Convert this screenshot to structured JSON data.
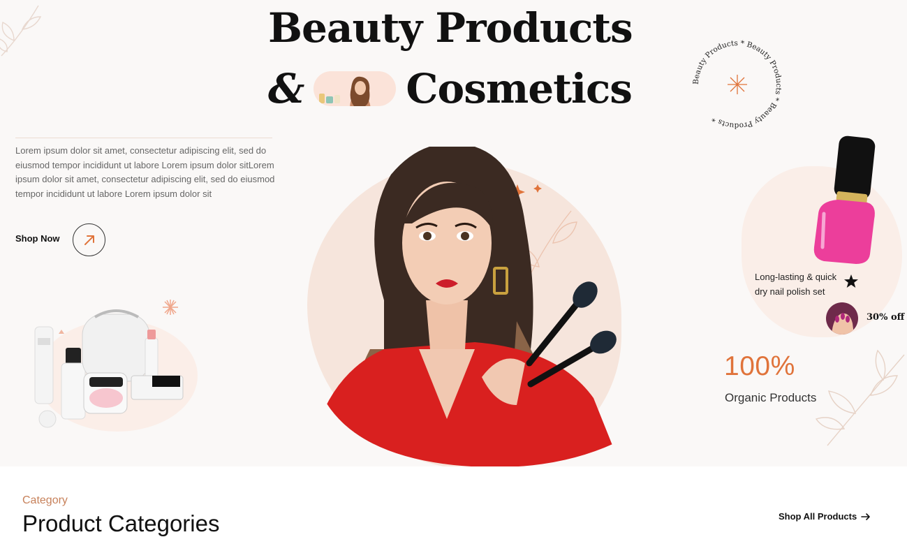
{
  "hero": {
    "title_line1": "Beauty Products",
    "title_amp": "&",
    "title_line2": "Cosmetics",
    "intro_text": "Lorem ipsum dolor sit amet, consectetur adipiscing elit, sed do eiusmod tempor incididunt ut labore Lorem ipsum dolor sitLorem ipsum dolor sit amet, consectetur adipiscing elit, sed do eiusmod tempor incididunt ut labore Lorem ipsum dolor sit",
    "shop_now_label": "Shop Now",
    "shop_now_icon": "arrow-up-right-icon",
    "stamp_text": "Beauty Products * Beauty Products * Beauty Products * ",
    "nail_caption": "Long-lasting & quick dry nail polish set",
    "discount": "30% off",
    "stat_value": "100%",
    "stat_label": "Organic Products"
  },
  "category": {
    "eyebrow": "Category",
    "title": "Product Categories",
    "shop_all_label": "Shop All Products",
    "shop_all_icon": "arrow-right-icon"
  },
  "colors": {
    "accent": "#e0733a",
    "eyebrow": "#c7815a",
    "blush": "#f6e5dc",
    "nail_pink": "#ec3e9b",
    "dress_red": "#d9201f"
  }
}
